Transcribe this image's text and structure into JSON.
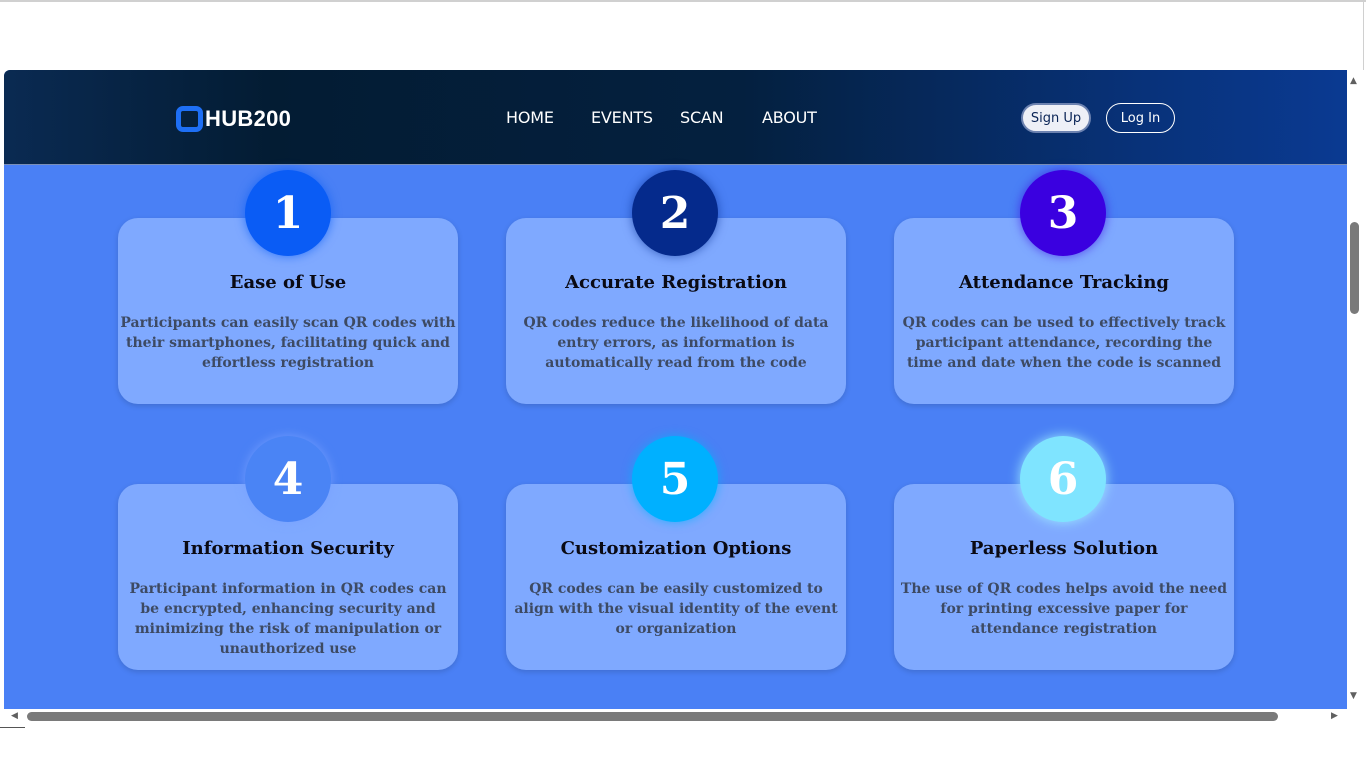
{
  "brand": {
    "name": "HUB200",
    "accent": "#1e6ff5"
  },
  "nav": {
    "links": [
      "HOME",
      "EVENTS",
      "SCAN",
      "ABOUT"
    ],
    "signup_label": "Sign Up",
    "login_label": "Log In"
  },
  "features": [
    {
      "number": "1",
      "title": "Ease of Use",
      "description": "Participants can easily scan QR codes with their smartphones, facilitating quick and effortless registration",
      "color": "#0a5cf5"
    },
    {
      "number": "2",
      "title": "Accurate Registration",
      "description": "QR codes reduce the likelihood of data entry errors, as information is automatically read from the code",
      "color": "#052a8c"
    },
    {
      "number": "3",
      "title": "Attendance Tracking",
      "description": "QR codes can be used to effectively track participant attendance, recording the time and date when the code is scanned",
      "color": "#3a00e0"
    },
    {
      "number": "4",
      "title": "Information Security",
      "description": "Participant information in QR codes can be encrypted, enhancing security and minimizing the risk of manipulation or unauthorized use",
      "color": "#4a84f5"
    },
    {
      "number": "5",
      "title": "Customization Options",
      "description": "QR codes can be easily customized to align with the visual identity of the event or organization",
      "color": "#00b0ff"
    },
    {
      "number": "6",
      "title": "Paperless Solution",
      "description": "The use of QR codes helps avoid the need for printing excessive paper for attendance registration",
      "color": "#7fe4ff"
    }
  ],
  "colors": {
    "page_background": "#4a80f5",
    "card_background": "#7fa9ff",
    "navbar": "#04203f"
  }
}
